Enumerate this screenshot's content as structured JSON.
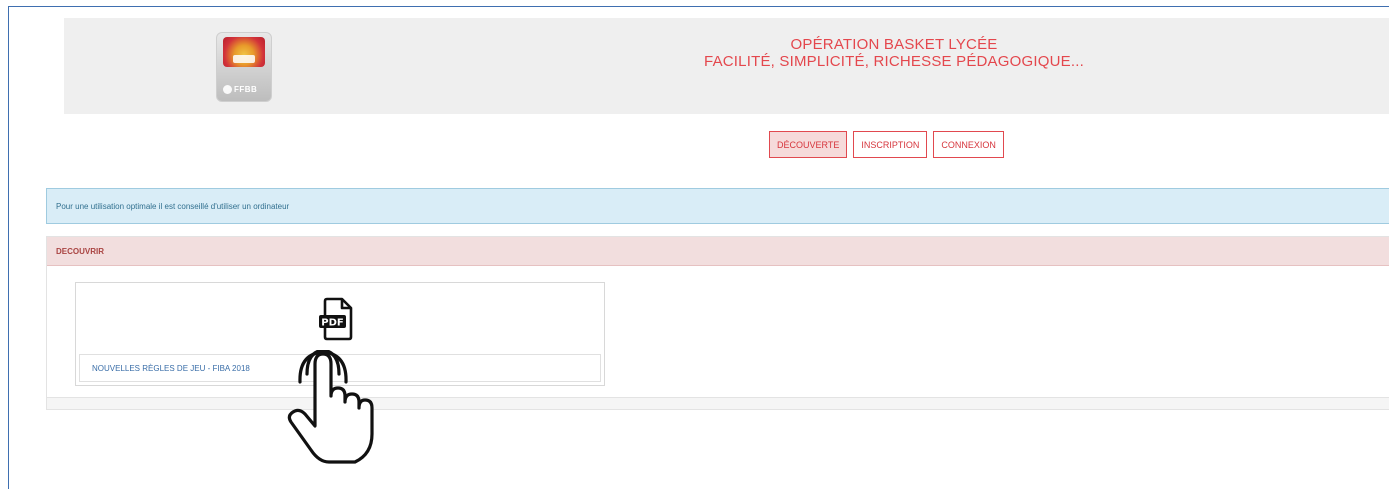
{
  "header": {
    "title_line1": "OPÉRATION BASKET LYCÉE",
    "title_line2": "FACILITÉ, SIMPLICITÉ, RICHESSE PÉDAGOGIQUE...",
    "logo_text": "FFBB",
    "accent_color": "#e4474d"
  },
  "nav": {
    "items": [
      {
        "label": "DÉCOUVERTE",
        "active": true
      },
      {
        "label": "INSCRIPTION",
        "active": false
      },
      {
        "label": "CONNEXION",
        "active": false
      }
    ]
  },
  "info_banner": {
    "text": "Pour une utilisation optimale il est conseillé d'utiliser un ordinateur"
  },
  "panel": {
    "heading": "DECOUVRIR",
    "documents": [
      {
        "icon": "pdf-file-icon",
        "label": "NOUVELLES RÈGLES DE JEU - FIBA 2018"
      }
    ]
  },
  "overlay": {
    "icon": "pointing-hand-icon"
  }
}
